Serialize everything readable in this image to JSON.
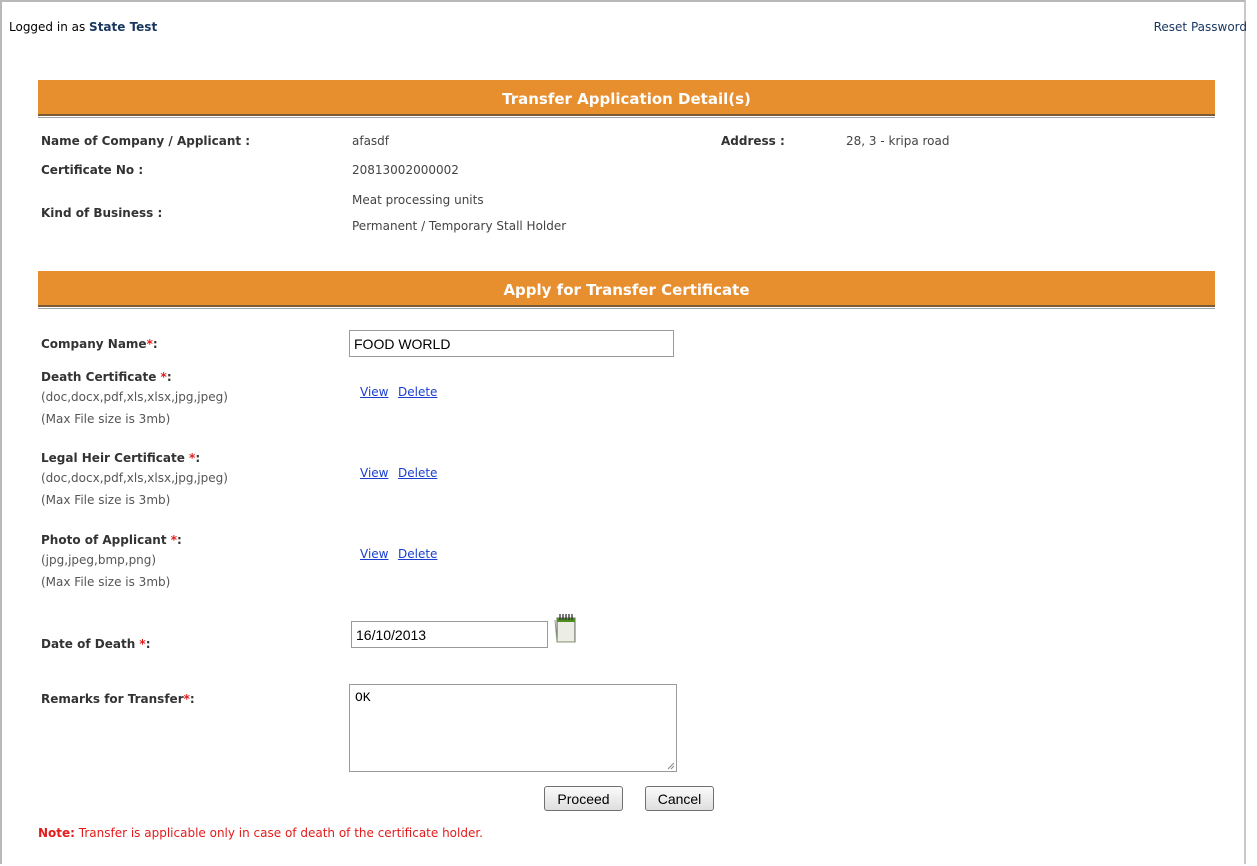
{
  "header": {
    "logged_in_prefix": "Logged in as ",
    "user_name": "State Test",
    "reset_password": "Reset Password"
  },
  "details": {
    "title": "Transfer Application Detail(s)",
    "company_label": "Name of Company / Applicant :",
    "company_value": "afasdf",
    "address_label": "Address :",
    "address_value": "28, 3 - kripa road",
    "certificate_label": "Certificate No :",
    "certificate_value": "20813002000002",
    "business_label": "Kind of Business :",
    "business_line1": "Meat processing units",
    "business_line2": "Permanent / Temporary Stall Holder"
  },
  "form": {
    "title": "Apply for Transfer Certificate",
    "company_name_label": "Company Name",
    "company_name_value": "FOOD WORLD",
    "required_mark": "*",
    "colon": ":",
    "death_cert_label": "Death Certificate ",
    "death_cert_types": "(doc,docx,pdf,xls,xlsx,jpg,jpeg)",
    "death_cert_size": "(Max File size is 3mb)",
    "heir_cert_label": "Legal Heir Certificate ",
    "heir_cert_types": "(doc,docx,pdf,xls,xlsx,jpg,jpeg)",
    "heir_cert_size": "(Max File size is 3mb)",
    "photo_label": "Photo of Applicant ",
    "photo_types": "(jpg,jpeg,bmp,png)",
    "photo_size": "(Max File size is 3mb)",
    "view": "View",
    "delete": "Delete",
    "date_label": "Date of Death ",
    "date_value": "16/10/2013",
    "remarks_label": "Remarks for Transfer",
    "remarks_value": "OK",
    "proceed": "Proceed",
    "cancel": "Cancel"
  },
  "note": {
    "prefix": "Note:",
    "text": " Transfer is applicable only in case of death of the certificate holder."
  },
  "colors": {
    "section_bar": "#e78e2e",
    "required": "#e31b1b",
    "link": "#1a3ed0"
  },
  "icons": {
    "calendar": "calendar-icon"
  }
}
